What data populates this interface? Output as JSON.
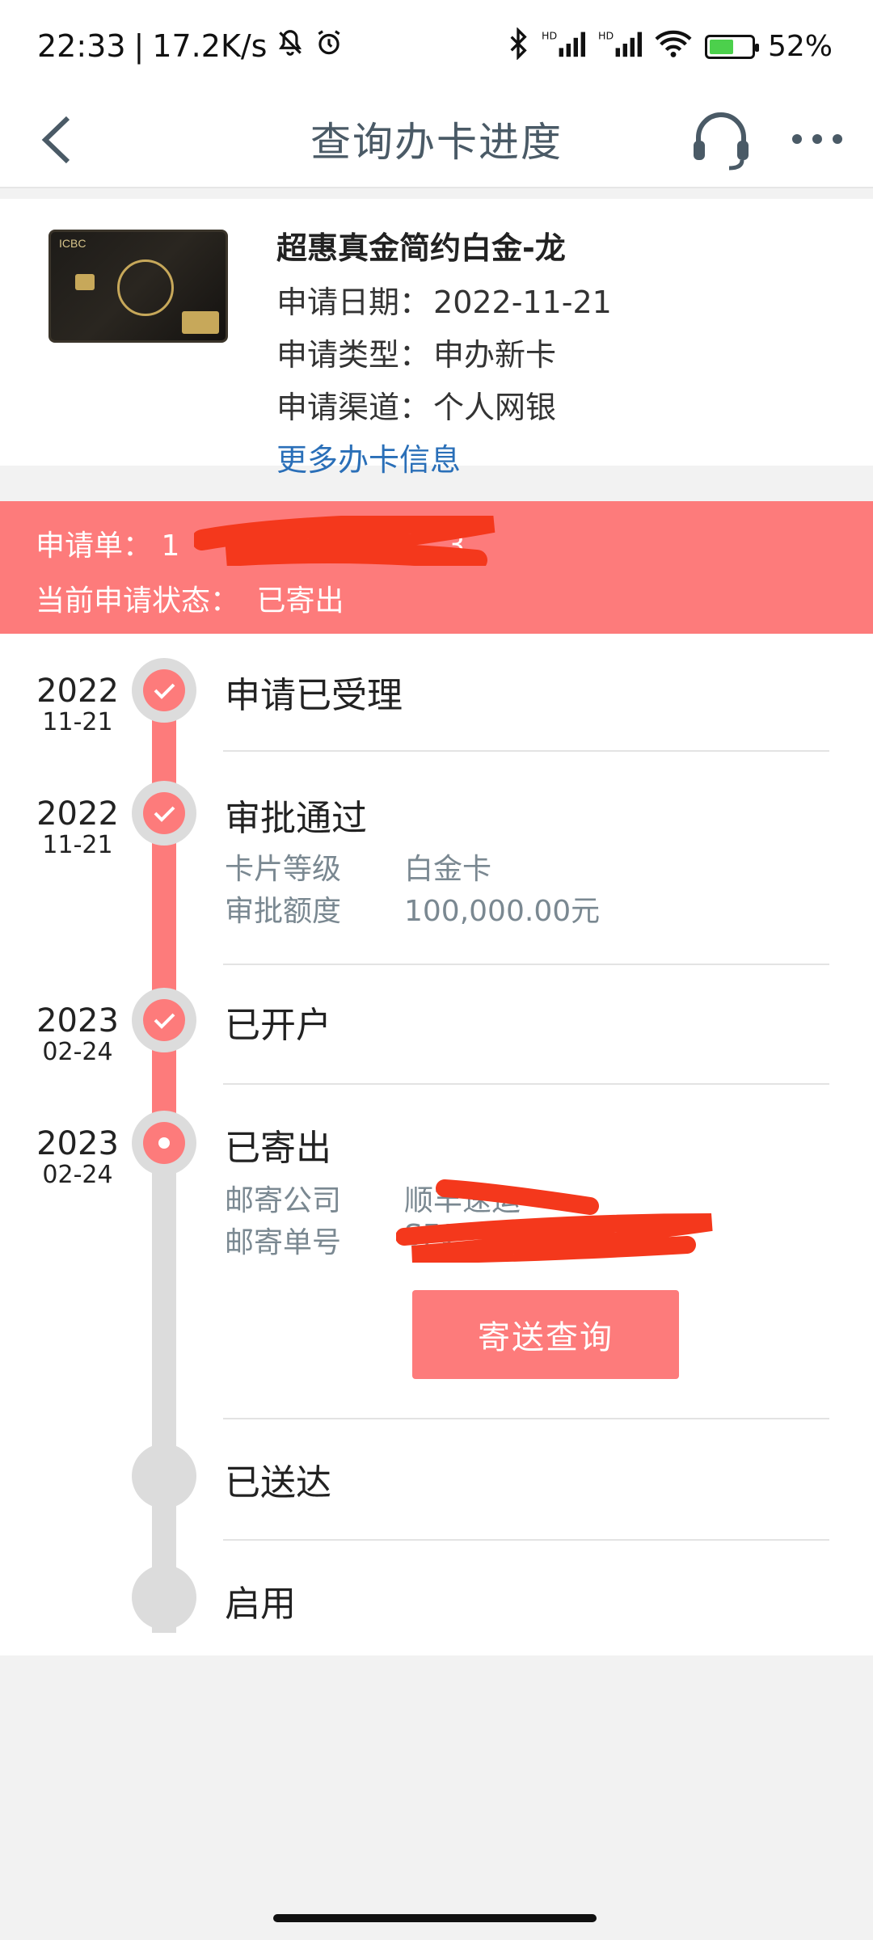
{
  "status_bar": {
    "time": "22:33",
    "separator": "|",
    "net_speed": "17.2K/s",
    "battery_pct": "52%",
    "battery_level": 0.52,
    "icons": [
      "mute-bell-icon",
      "alarm-icon",
      "bluetooth-icon",
      "hd-signal-icon",
      "hd-signal-icon",
      "wifi-icon",
      "battery-charging-icon"
    ]
  },
  "header": {
    "title": "查询办卡进度",
    "back_icon": "chevron-left-icon",
    "service_icon": "headset-icon",
    "more_icon": "more-dots-icon"
  },
  "card": {
    "image_label": "ICBC",
    "name": "超惠真金简约白金-龙",
    "lines": [
      {
        "label": "申请日期：",
        "value": "2022-11-21"
      },
      {
        "label": "申请类型：",
        "value": "申办新卡"
      },
      {
        "label": "申请渠道：",
        "value": "个人网银"
      }
    ],
    "more_link": "更多办卡信息"
  },
  "application": {
    "number_label": "申请单：",
    "number_prefix": "1",
    "number_suffix": "3",
    "status_label": "当前申请状态：",
    "status_value": "已寄出",
    "accent_color": "#fd7b7b"
  },
  "timeline": [
    {
      "year": "2022",
      "md": "11-21",
      "title": "申请已受理",
      "done": true
    },
    {
      "year": "2022",
      "md": "11-21",
      "title": "审批通过",
      "done": true,
      "details": [
        {
          "label": "卡片等级",
          "value": "白金卡"
        },
        {
          "label": "审批额度",
          "value": "100,000.00元"
        }
      ]
    },
    {
      "year": "2023",
      "md": "02-24",
      "title": "已开户",
      "done": true
    },
    {
      "year": "2023",
      "md": "02-24",
      "title": "已寄出",
      "current": true,
      "details": [
        {
          "label": "邮寄公司",
          "value": "顺丰速运"
        },
        {
          "label": "邮寄单号",
          "value": "SF1"
        }
      ],
      "button": "寄送查询"
    },
    {
      "title": "已送达",
      "done": false
    },
    {
      "title": "启用",
      "done": false
    }
  ]
}
